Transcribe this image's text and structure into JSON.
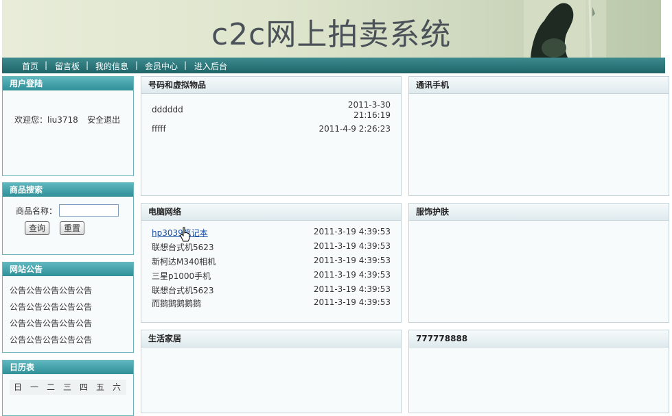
{
  "header": {
    "site_title": "c2c网上拍卖系统"
  },
  "nav": {
    "items": [
      {
        "label": "首页"
      },
      {
        "label": "留言板"
      },
      {
        "label": "我的信息"
      },
      {
        "label": "会员中心"
      },
      {
        "label": "进入后台"
      }
    ],
    "separator": "|"
  },
  "login": {
    "title": "用户登陆",
    "welcome": "欢迎您：liu3718",
    "logout": "安全退出"
  },
  "search": {
    "title": "商品搜索",
    "field_label": "商品名称：",
    "field_value": "",
    "query_button": "查询",
    "reset_button": "重置"
  },
  "notices": {
    "title": "网站公告",
    "items": [
      "公告公告公告公告公告",
      "公告公告公告公告公告",
      "公告公告公告公告公告",
      "公告公告公告公告公告"
    ]
  },
  "calendar": {
    "title": "日历表",
    "weekdays": [
      "日",
      "一",
      "二",
      "三",
      "四",
      "五",
      "六"
    ]
  },
  "categories": [
    {
      "title": "号码和虚拟物品",
      "items": [
        {
          "name": "dddddd",
          "date_line1": "2011-3-30",
          "date_line2": "21:16:19"
        },
        {
          "name": "fffff",
          "date": "2011-4-9 2:26:23"
        }
      ]
    },
    {
      "title": "通讯手机",
      "items": []
    },
    {
      "title": "电脑网络",
      "items": [
        {
          "name": "hp3039笔记本",
          "date": "2011-3-19 4:39:53"
        },
        {
          "name": "联想台式机5623",
          "date": "2011-3-19 4:39:53"
        },
        {
          "name": "新柯达M340相机",
          "date": "2011-3-19 4:39:53"
        },
        {
          "name": "三星p1000手机",
          "date": "2011-3-19 4:39:53"
        },
        {
          "name": "联想台式机5623",
          "date": "2011-3-19 4:39:53"
        },
        {
          "name": "而鹅鹅鹅鹅鹅",
          "date": "2011-3-19 4:39:53"
        }
      ]
    },
    {
      "title": "服饰护肤",
      "items": []
    },
    {
      "title": "生活家居",
      "items": []
    },
    {
      "title": "777778888",
      "items": []
    }
  ]
}
